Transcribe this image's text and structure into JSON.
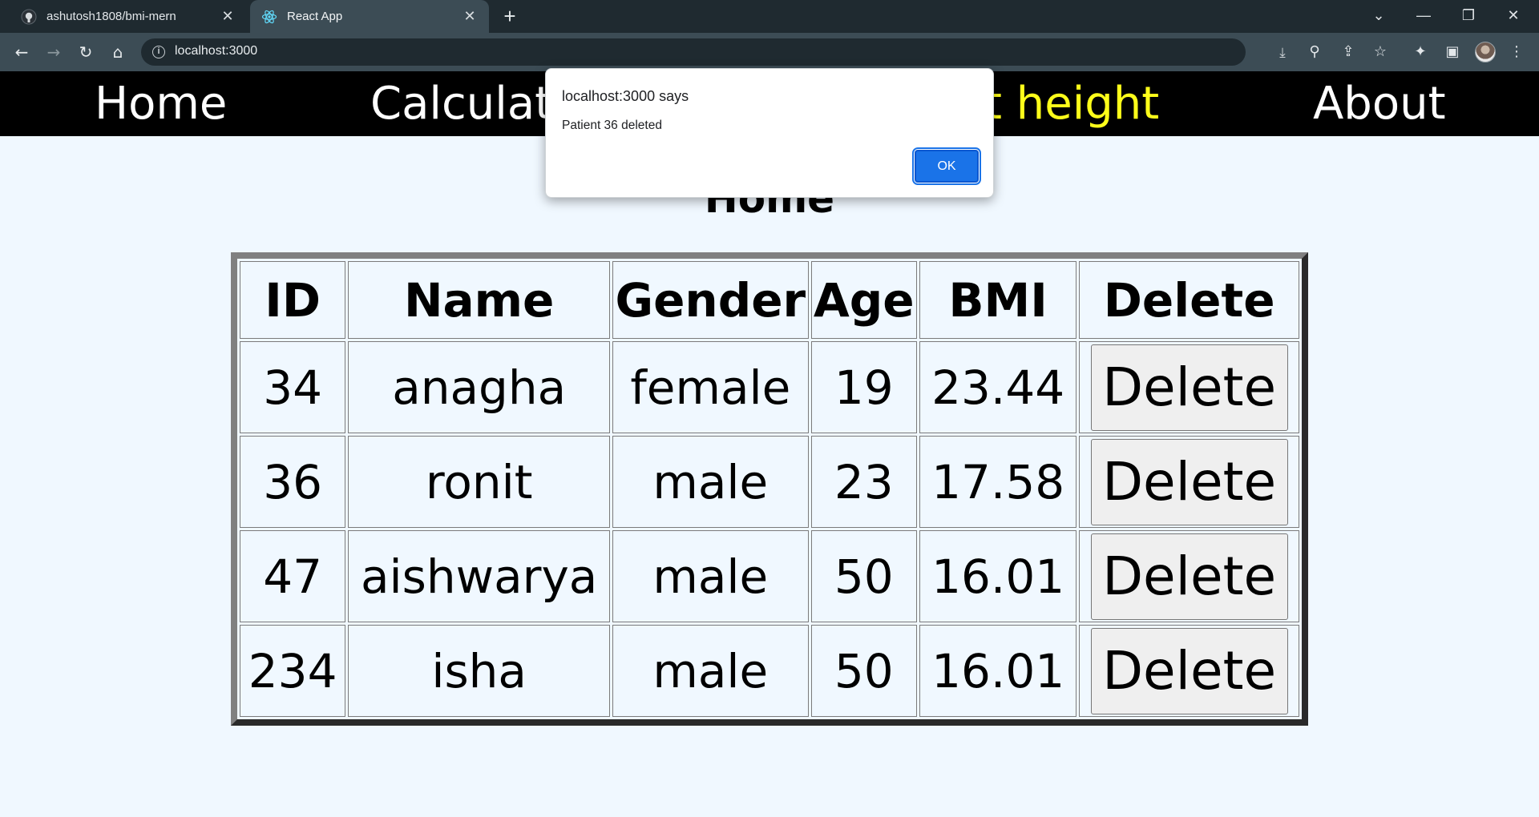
{
  "browser": {
    "tabs": [
      {
        "title": "ashutosh1808/bmi-mern",
        "favicon": "github-icon",
        "active": false
      },
      {
        "title": "React App",
        "favicon": "react-icon",
        "active": true
      }
    ],
    "url": "localhost:3000"
  },
  "navbar": {
    "items": [
      {
        "label": "Home"
      },
      {
        "label": "Calculat"
      },
      {
        "label": "t height"
      },
      {
        "label": "About"
      }
    ],
    "active_color": "#ffff1a"
  },
  "page": {
    "title": "Home"
  },
  "table": {
    "headers": [
      "ID",
      "Name",
      "Gender",
      "Age",
      "BMI",
      "Delete"
    ],
    "rows": [
      {
        "id": "34",
        "name": "anagha",
        "gender": "female",
        "age": "19",
        "bmi": "23.44",
        "action": "Delete"
      },
      {
        "id": "36",
        "name": "ronit",
        "gender": "male",
        "age": "23",
        "bmi": "17.58",
        "action": "Delete"
      },
      {
        "id": "47",
        "name": "aishwarya",
        "gender": "male",
        "age": "50",
        "bmi": "16.01",
        "action": "Delete"
      },
      {
        "id": "234",
        "name": "isha",
        "gender": "male",
        "age": "50",
        "bmi": "16.01",
        "action": "Delete"
      }
    ]
  },
  "dialog": {
    "title": "localhost:3000 says",
    "message": "Patient 36 deleted",
    "ok_label": "OK"
  }
}
